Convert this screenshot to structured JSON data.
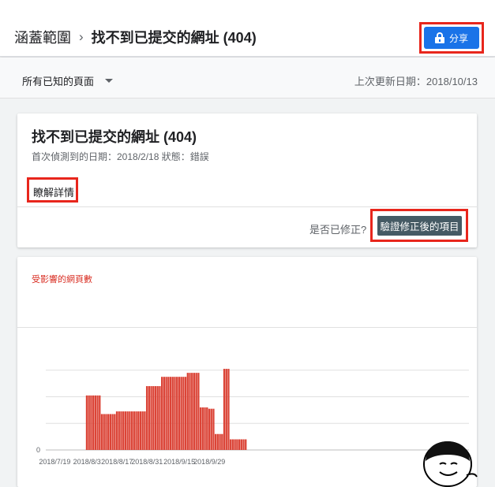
{
  "header": {
    "breadcrumb_root": "涵蓋範圍",
    "breadcrumb_sep": "›",
    "breadcrumb_current": "找不到已提交的網址 (404)",
    "share_label": "分享"
  },
  "filter": {
    "dropdown_label": "所有已知的頁面",
    "last_updated": "上次更新日期：2018/10/13"
  },
  "issue_card": {
    "title": "找不到已提交的網址 (404)",
    "meta": "首次偵測到的日期：2018/2/18  狀態：錯誤",
    "learn_more": "瞭解詳情",
    "fixed_question": "是否已修正?",
    "validate_button": "驗證修正後的項目"
  },
  "chart_card": {
    "title": "受影響的網頁數"
  },
  "colors": {
    "accent": "#1a73e8",
    "bar": "#db4437",
    "highlight": "#e8261c",
    "validate_button": "#455a64"
  },
  "chart_data": {
    "type": "bar",
    "title": "受影響的網頁數",
    "xlabel": "",
    "ylabel": "",
    "x_tick_labels": [
      "2018/7/19",
      "2018/8/3",
      "2018/8/17",
      "2018/8/31",
      "2018/9/15",
      "2018/9/29"
    ],
    "y_tick_labels": [
      "0"
    ],
    "ylim": [
      0,
      4
    ],
    "grid": true,
    "categories": [
      "2018/7/19",
      "2018/7/20",
      "2018/7/21",
      "2018/7/22",
      "2018/7/23",
      "2018/7/24",
      "2018/7/25",
      "2018/7/26",
      "2018/7/27",
      "2018/7/28",
      "2018/7/29",
      "2018/7/30",
      "2018/7/31",
      "2018/8/1",
      "2018/8/2",
      "2018/8/3",
      "2018/8/4",
      "2018/8/5",
      "2018/8/6",
      "2018/8/7",
      "2018/8/8",
      "2018/8/9",
      "2018/8/10",
      "2018/8/11",
      "2018/8/12",
      "2018/8/13",
      "2018/8/14",
      "2018/8/15",
      "2018/8/16",
      "2018/8/17",
      "2018/8/18",
      "2018/8/19",
      "2018/8/20",
      "2018/8/21",
      "2018/8/22",
      "2018/8/23",
      "2018/8/24",
      "2018/8/25",
      "2018/8/26",
      "2018/8/27",
      "2018/8/28",
      "2018/8/29",
      "2018/8/30",
      "2018/8/31",
      "2018/9/1",
      "2018/9/2",
      "2018/9/3",
      "2018/9/4",
      "2018/9/5",
      "2018/9/6",
      "2018/9/7",
      "2018/9/8",
      "2018/9/9",
      "2018/9/10",
      "2018/9/11",
      "2018/9/12",
      "2018/9/13",
      "2018/9/14",
      "2018/9/15",
      "2018/9/16",
      "2018/9/17",
      "2018/9/18",
      "2018/9/19",
      "2018/9/20",
      "2018/9/21",
      "2018/9/22",
      "2018/9/23",
      "2018/9/24",
      "2018/9/25",
      "2018/9/26",
      "2018/9/27",
      "2018/9/28",
      "2018/9/29",
      "2018/9/30",
      "2018/10/1",
      "2018/10/2",
      "2018/10/3",
      "2018/10/4",
      "2018/10/5",
      "2018/10/6",
      "2018/10/7",
      "2018/10/8",
      "2018/10/9",
      "2018/10/10"
    ],
    "values": [
      0,
      0,
      0,
      0,
      0,
      0,
      0,
      0,
      0,
      0,
      0,
      0,
      0,
      0,
      0,
      2.05,
      2.05,
      2.05,
      2.05,
      2.05,
      2.05,
      2.05,
      1.35,
      1.35,
      1.35,
      1.35,
      1.35,
      1.35,
      1.35,
      1.45,
      1.45,
      1.45,
      1.45,
      1.45,
      1.45,
      1.45,
      1.45,
      1.45,
      1.45,
      1.45,
      1.45,
      1.45,
      1.45,
      2.4,
      2.4,
      2.4,
      2.4,
      2.4,
      2.4,
      2.4,
      2.75,
      2.75,
      2.75,
      2.75,
      2.75,
      2.75,
      2.75,
      2.75,
      2.75,
      2.75,
      2.75,
      2.75,
      2.9,
      2.9,
      2.9,
      2.9,
      2.9,
      2.9,
      1.6,
      1.6,
      1.6,
      1.6,
      1.55,
      1.55,
      1.55,
      0.6,
      0.6,
      0.6,
      0.6,
      3.05,
      3.05,
      3.05,
      0.4,
      0.4,
      0.4,
      0.4,
      0.4,
      0.4,
      0.4,
      0.4
    ],
    "legend": "none"
  }
}
